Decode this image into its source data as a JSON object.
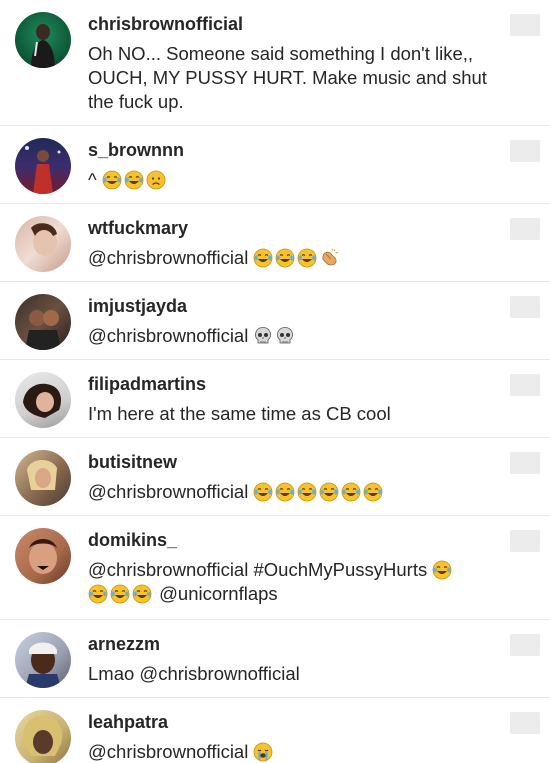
{
  "comments": [
    {
      "username": "chrisbrownofficial",
      "text": "Oh NO... Someone said something I don't like,, OUCH, MY PUSSY HURT. Make music and shut the fuck up."
    },
    {
      "username": "s_brownnn",
      "text": "^"
    },
    {
      "username": "wtfuckmary",
      "text": "@chrisbrownofficial"
    },
    {
      "username": "imjustjayda",
      "text": "@chrisbrownofficial"
    },
    {
      "username": "filipadmartins",
      "text": "I'm here at the same time as CB cool"
    },
    {
      "username": "butisitnew",
      "text": "@chrisbrownofficial"
    },
    {
      "username": "domikins_",
      "text": "@chrisbrownofficial #OuchMyPussyHurts",
      "text2": "@unicornflaps"
    },
    {
      "username": "arnezzm",
      "text": "Lmao @chrisbrownofficial"
    },
    {
      "username": "leahpatra",
      "text": "@chrisbrownofficial"
    }
  ],
  "icons": {
    "laugh": "face-with-tears-of-joy-icon",
    "sad": "sad-face-icon",
    "skull": "skull-icon",
    "clap": "clapping-hands-icon",
    "cry": "loudly-crying-face-icon"
  },
  "colors": {
    "text": "#262626",
    "divider": "#e8e8e8",
    "emoji_yellow": "#f7c230"
  }
}
